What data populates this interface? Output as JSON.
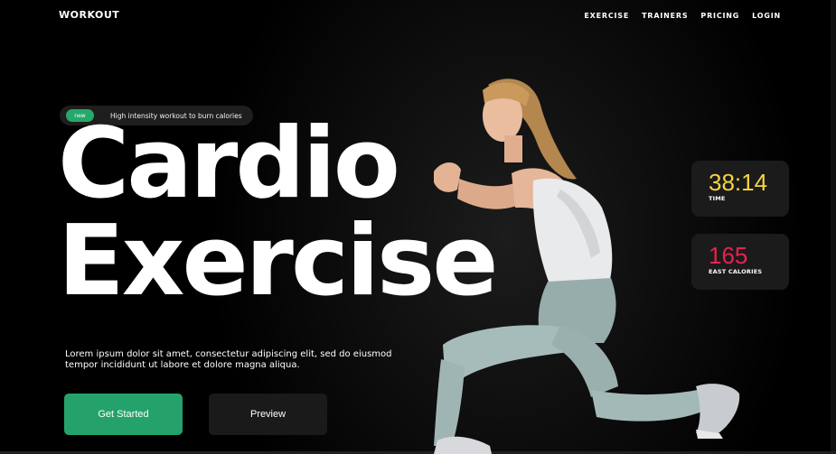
{
  "brand": {
    "logo": "WORKOUT"
  },
  "nav": {
    "items": [
      "EXERCISE",
      "TRAINERS",
      "PRICING",
      "LOGIN"
    ]
  },
  "hero": {
    "badge": "new",
    "tagline": "High intensity workout to burn calories",
    "title_line1": "Cardio",
    "title_line2": "Exercise",
    "description": "Lorem ipsum dolor sit amet, consectetur adipiscing elit, sed do eiusmod tempor incididunt ut labore et dolore magna aliqua.",
    "cta_primary": "Get Started",
    "cta_secondary": "Preview"
  },
  "stats": {
    "time": {
      "value": "38:14",
      "label": "TIME",
      "color": "#f5d53f"
    },
    "calories": {
      "value": "165",
      "label": "EAST CALORIES",
      "color": "#e8214f"
    }
  },
  "colors": {
    "accent": "#25a26b",
    "background": "#000000"
  }
}
